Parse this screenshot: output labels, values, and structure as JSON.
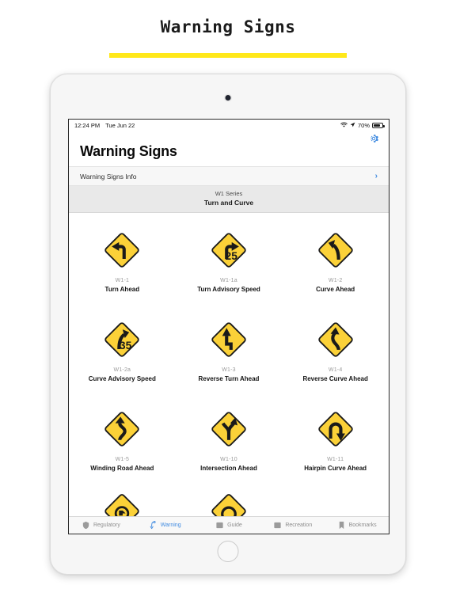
{
  "page": {
    "title": "Warning Signs",
    "accent_rule_color": "#ffe81a"
  },
  "device": {
    "name": "ipad-frame",
    "home_button": "home-button",
    "camera": "front-camera"
  },
  "statusbar": {
    "time": "12:24 PM",
    "date": "Tue Jun 22",
    "wifi_icon": "wifi-icon",
    "location_icon": "location-arrow-icon",
    "battery_percent": "70%",
    "battery_icon": "battery-icon"
  },
  "header": {
    "title": "Warning Signs",
    "settings_icon": "gear-icon",
    "settings_color": "#3f8ae0"
  },
  "info_row": {
    "label": "Warning Signs Info",
    "chevron": "›"
  },
  "section": {
    "series": "W1 Series",
    "name": "Turn and Curve"
  },
  "signs": [
    {
      "code": "W1-1",
      "label": "Turn Ahead",
      "icon": "sign-turn-left",
      "value": ""
    },
    {
      "code": "W1-1a",
      "label": "Turn Advisory Speed",
      "icon": "sign-turn-right-speed",
      "value": "25"
    },
    {
      "code": "W1-2",
      "label": "Curve Ahead",
      "icon": "sign-curve-left",
      "value": ""
    },
    {
      "code": "W1-2a",
      "label": "Curve Advisory Speed",
      "icon": "sign-curve-right-speed",
      "value": "35"
    },
    {
      "code": "W1-3",
      "label": "Reverse Turn Ahead",
      "icon": "sign-reverse-turn",
      "value": ""
    },
    {
      "code": "W1-4",
      "label": "Reverse Curve Ahead",
      "icon": "sign-reverse-curve",
      "value": ""
    },
    {
      "code": "W1-5",
      "label": "Winding Road Ahead",
      "icon": "sign-winding-road",
      "value": ""
    },
    {
      "code": "W1-10",
      "label": "Intersection Ahead",
      "icon": "sign-intersection",
      "value": ""
    },
    {
      "code": "W1-11",
      "label": "Hairpin Curve Ahead",
      "icon": "sign-hairpin-curve",
      "value": ""
    }
  ],
  "partial_row": [
    {
      "code": "",
      "label": "",
      "icon": "sign-partial-a"
    },
    {
      "code": "",
      "label": "",
      "icon": "sign-partial-b"
    },
    {
      "code": "",
      "label": "",
      "icon": ""
    }
  ],
  "tabs": [
    {
      "label": "Regulatory",
      "icon": "shield-icon",
      "active": false
    },
    {
      "label": "Warning",
      "icon": "curve-icon",
      "active": true
    },
    {
      "label": "Guide",
      "icon": "square-icon",
      "active": false
    },
    {
      "label": "Recreation",
      "icon": "square-icon",
      "active": false
    },
    {
      "label": "Bookmarks",
      "icon": "bookmark-icon",
      "active": false
    }
  ],
  "colors": {
    "sign_yellow": "#fbd138",
    "sign_border": "#1a1a1a",
    "accent_blue": "#3f8ae0",
    "tab_inactive": "#9b9b9b"
  }
}
